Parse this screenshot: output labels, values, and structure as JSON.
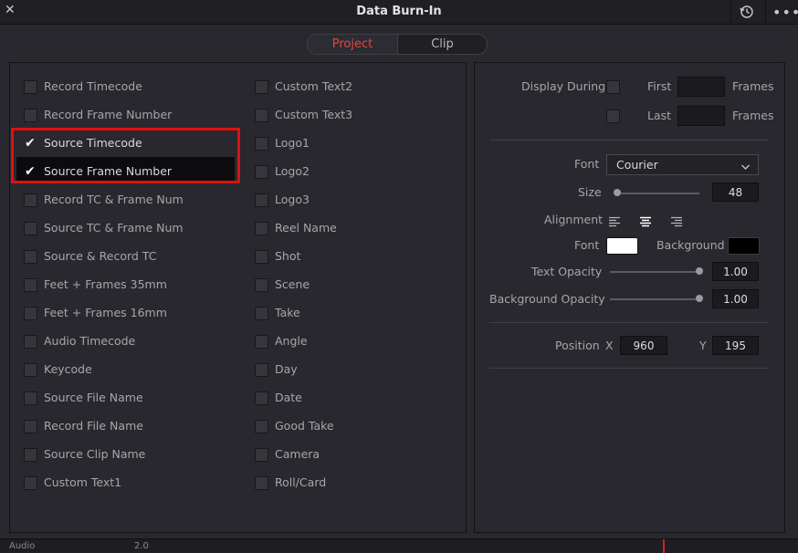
{
  "window": {
    "title": "Data Burn-In"
  },
  "tabs": {
    "project": "Project",
    "clip": "Clip"
  },
  "col1": [
    {
      "label": "Record Timecode",
      "checked": false
    },
    {
      "label": "Record Frame Number",
      "checked": false
    },
    {
      "label": "Source Timecode",
      "checked": true
    },
    {
      "label": "Source Frame Number",
      "checked": true
    },
    {
      "label": "Record TC & Frame Num",
      "checked": false
    },
    {
      "label": "Source TC & Frame Num",
      "checked": false
    },
    {
      "label": "Source & Record TC",
      "checked": false
    },
    {
      "label": "Feet + Frames 35mm",
      "checked": false
    },
    {
      "label": "Feet + Frames 16mm",
      "checked": false
    },
    {
      "label": "Audio Timecode",
      "checked": false
    },
    {
      "label": "Keycode",
      "checked": false
    },
    {
      "label": "Source File Name",
      "checked": false
    },
    {
      "label": "Record File Name",
      "checked": false
    },
    {
      "label": "Source Clip Name",
      "checked": false
    },
    {
      "label": "Custom Text1",
      "checked": false
    }
  ],
  "col2": [
    {
      "label": "Custom Text2",
      "checked": false
    },
    {
      "label": "Custom Text3",
      "checked": false
    },
    {
      "label": "Logo1",
      "checked": false
    },
    {
      "label": "Logo2",
      "checked": false
    },
    {
      "label": "Logo3",
      "checked": false
    },
    {
      "label": "Reel Name",
      "checked": false
    },
    {
      "label": "Shot",
      "checked": false
    },
    {
      "label": "Scene",
      "checked": false
    },
    {
      "label": "Take",
      "checked": false
    },
    {
      "label": "Angle",
      "checked": false
    },
    {
      "label": "Day",
      "checked": false
    },
    {
      "label": "Date",
      "checked": false
    },
    {
      "label": "Good Take",
      "checked": false
    },
    {
      "label": "Camera",
      "checked": false
    },
    {
      "label": "Roll/Card",
      "checked": false
    }
  ],
  "display": {
    "label": "Display During",
    "first_label": "First",
    "last_label": "Last",
    "frames_label": "Frames",
    "first_value": "",
    "last_value": ""
  },
  "font": {
    "label": "Font",
    "value": "Courier"
  },
  "size": {
    "label": "Size",
    "value": "48",
    "slider_fraction": 0.0
  },
  "alignment": {
    "label": "Alignment",
    "options": [
      "align-left",
      "align-center",
      "align-right"
    ],
    "selected": "align-center"
  },
  "colors": {
    "font_label": "Font",
    "background_label": "Background",
    "font_color": "#ffffff",
    "background_color": "#000000"
  },
  "text_opacity": {
    "label": "Text Opacity",
    "value": "1.00",
    "slider_fraction": 1.0
  },
  "bg_opacity": {
    "label": "Background Opacity",
    "value": "1.00",
    "slider_fraction": 1.0
  },
  "position": {
    "label": "Position",
    "x_label": "X",
    "y_label": "Y",
    "x": "960",
    "y": "195"
  },
  "bottom": {
    "text1": "Audio",
    "text2": "2.0"
  },
  "accent": {
    "active_tab": "#e8443a",
    "highlight": "#dd1111"
  }
}
